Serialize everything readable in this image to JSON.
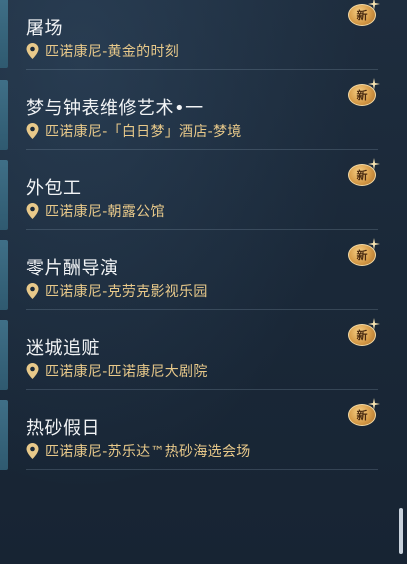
{
  "events": [
    {
      "title": "屠场",
      "location": "匹诺康尼-黄金的时刻",
      "badge": "新"
    },
    {
      "title": "梦与钟表维修艺术•一",
      "location": "匹诺康尼-「白日梦」酒店-梦境",
      "badge": "新"
    },
    {
      "title": "外包工",
      "location": "匹诺康尼-朝露公馆",
      "badge": "新"
    },
    {
      "title": "零片酬导演",
      "location": "匹诺康尼-克劳克影视乐园",
      "badge": "新"
    },
    {
      "title": "迷城追赃",
      "location": "匹诺康尼-匹诺康尼大剧院",
      "badge": "新"
    },
    {
      "title": "热砂假日",
      "location": "匹诺康尼-苏乐达™热砂海选会场",
      "badge": "新"
    }
  ],
  "icons": {
    "location": "location-pin-icon",
    "new_badge": "new-badge-icon",
    "sparkle": "sparkle-icon"
  },
  "colors": {
    "location_text": "#e8c98a",
    "title_text": "#f2f4f6",
    "badge_gold": "#d59a47",
    "side_bar": "#3f6f87"
  }
}
